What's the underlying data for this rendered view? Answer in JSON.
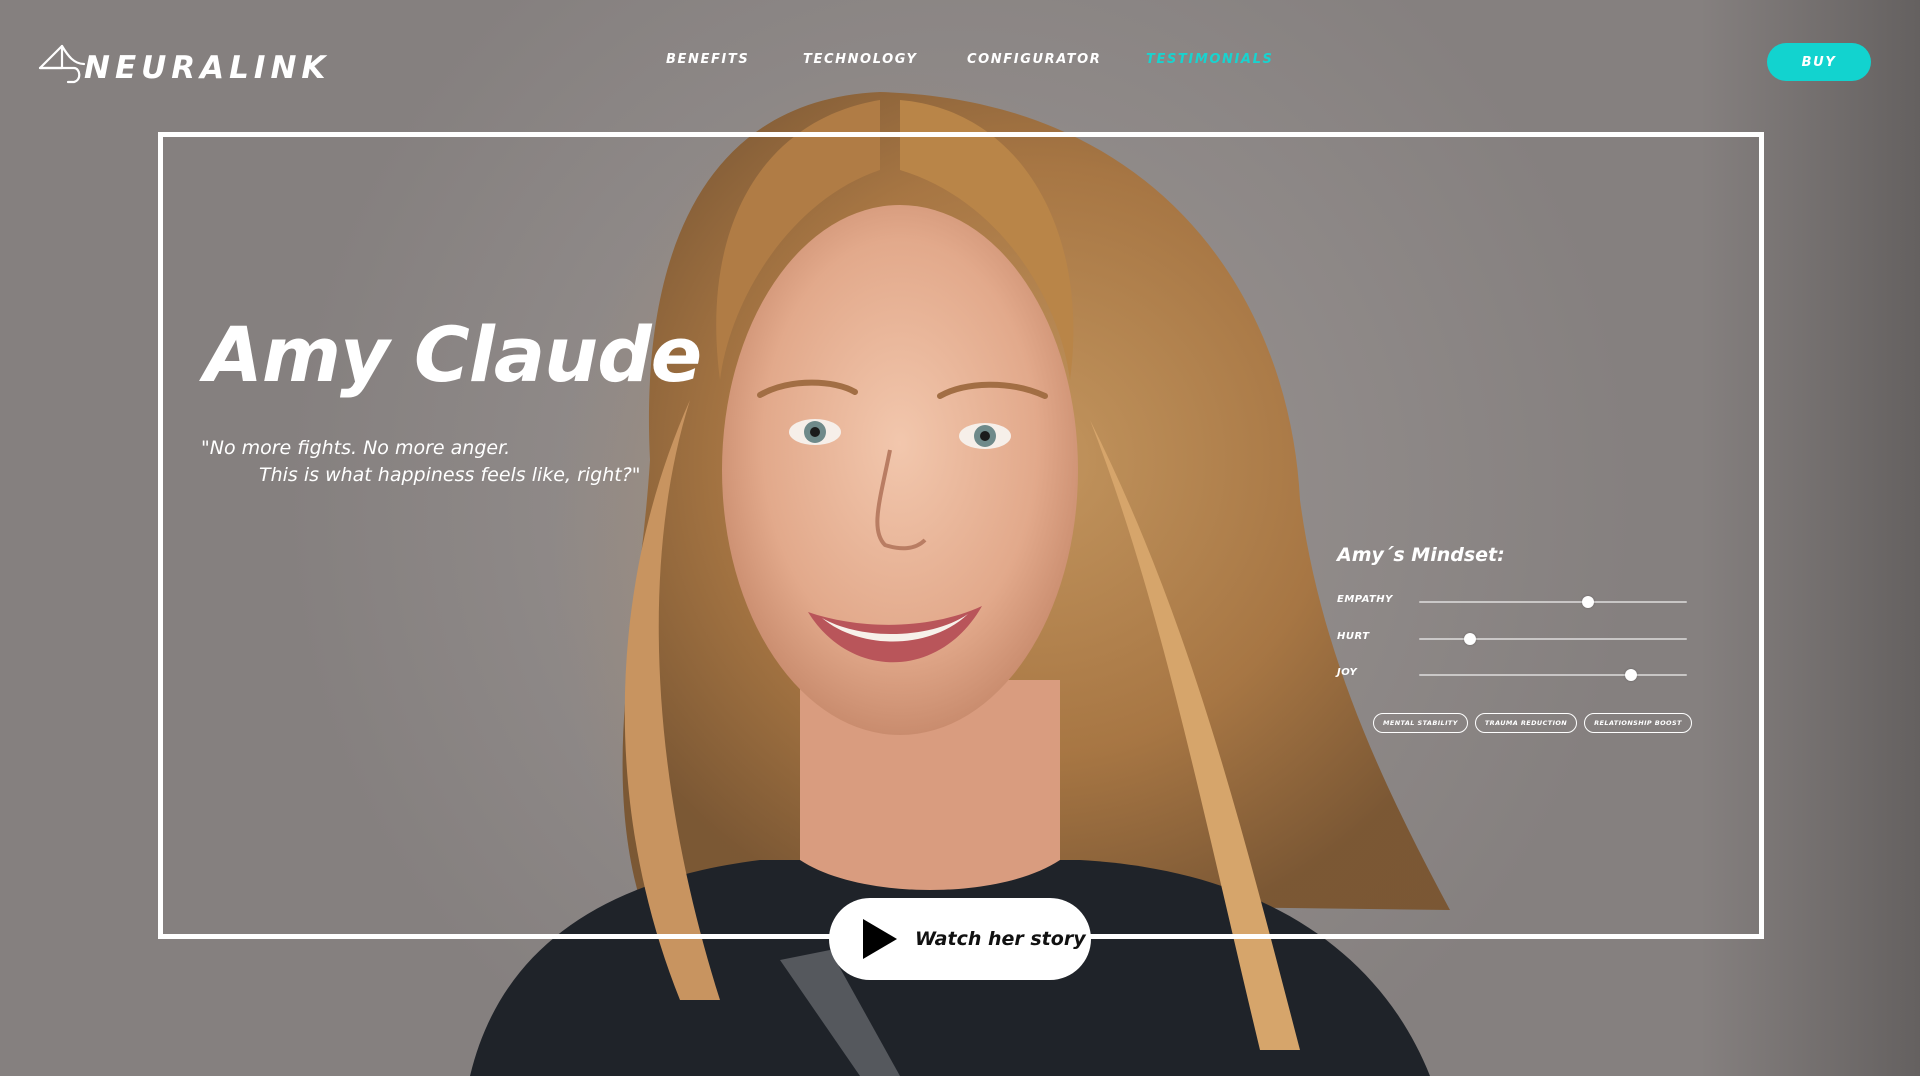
{
  "brand": {
    "name": "NEURALINK"
  },
  "nav": {
    "items": [
      {
        "label": "BENEFITS",
        "active": false
      },
      {
        "label": "TECHNOLOGY",
        "active": false
      },
      {
        "label": "CONFIGURATOR",
        "active": false
      },
      {
        "label": "TESTIMONIALS",
        "active": true
      }
    ],
    "buy_label": "BUY"
  },
  "colors": {
    "accent": "#12d3cf",
    "text": "#ffffff",
    "button_bg": "#ffffff"
  },
  "testimonial": {
    "name": "Amy Claude",
    "quote_line1": "\"No more fights. No more anger.",
    "quote_line2": "This is what happiness feels like, right?\""
  },
  "mindset": {
    "title": "Amy´s Mindset:",
    "sliders": [
      {
        "label": "EMPATHY",
        "value": 0.63
      },
      {
        "label": "HURT",
        "value": 0.19
      },
      {
        "label": "JOY",
        "value": 0.79
      }
    ],
    "tags": [
      "MENTAL STABILITY",
      "TRAUMA REDUCTION",
      "RELATIONSHIP BOOST"
    ]
  },
  "video": {
    "label": "Watch her story",
    "icon": "play-icon"
  }
}
